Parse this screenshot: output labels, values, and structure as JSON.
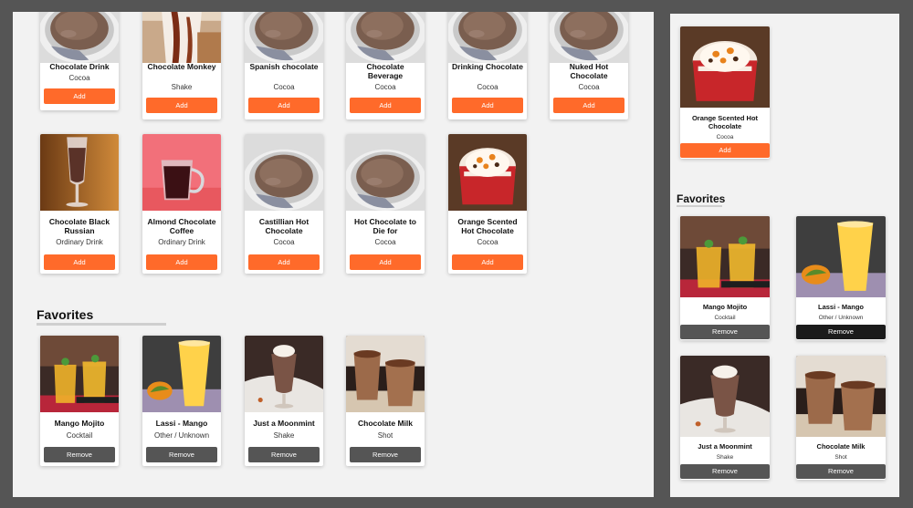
{
  "left": {
    "row1": [
      {
        "name": "Chocolate Drink",
        "category": "Cocoa",
        "button": "Add",
        "image": "cocoa-cup"
      },
      {
        "name": "Chocolate Monkey",
        "category": "Shake",
        "button": "Add",
        "image": "chocolate-monkey"
      },
      {
        "name": "Spanish chocolate",
        "category": "Cocoa",
        "button": "Add",
        "image": "cocoa-cup"
      },
      {
        "name": "Chocolate Beverage",
        "category": "Cocoa",
        "button": "Add",
        "image": "cocoa-cup"
      },
      {
        "name": "Drinking Chocolate",
        "category": "Cocoa",
        "button": "Add",
        "image": "cocoa-cup"
      },
      {
        "name": "Nuked Hot Chocolate",
        "category": "Cocoa",
        "button": "Add",
        "image": "cocoa-cup"
      }
    ],
    "row2": [
      {
        "name": "Chocolate Black Russian",
        "category": "Ordinary Drink",
        "button": "Add",
        "image": "black-russian"
      },
      {
        "name": "Almond Chocolate Coffee",
        "category": "Ordinary Drink",
        "button": "Add",
        "image": "almond-coffee"
      },
      {
        "name": "Castillian Hot Chocolate",
        "category": "Cocoa",
        "button": "Add",
        "image": "cocoa-cup"
      },
      {
        "name": "Hot Chocolate to Die for",
        "category": "Cocoa",
        "button": "Add",
        "image": "cocoa-cup"
      },
      {
        "name": "Orange Scented Hot Chocolate",
        "category": "Cocoa",
        "button": "Add",
        "image": "orange-mug"
      }
    ],
    "favorites_title": "Favorites",
    "favorites": [
      {
        "name": "Mango Mojito",
        "category": "Cocktail",
        "button": "Remove",
        "image": "mango-mojito"
      },
      {
        "name": "Lassi - Mango",
        "category": "Other / Unknown",
        "button": "Remove",
        "image": "lassi-mango"
      },
      {
        "name": "Just a Moonmint",
        "category": "Shake",
        "button": "Remove",
        "image": "moonmint"
      },
      {
        "name": "Chocolate Milk",
        "category": "Shot",
        "button": "Remove",
        "image": "chocolate-milk"
      }
    ]
  },
  "right": {
    "top_card": {
      "name": "Orange Scented Hot Chocolate",
      "category": "Cocoa",
      "button": "Add",
      "image": "orange-mug"
    },
    "favorites_title": "Favorites",
    "favorites": [
      {
        "name": "Mango Mojito",
        "category": "Cocktail",
        "button": "Remove",
        "image": "mango-mojito"
      },
      {
        "name": "Lassi - Mango",
        "category": "Other / Unknown",
        "button": "Remove",
        "image": "lassi-mango"
      },
      {
        "name": "Just a Moonmint",
        "category": "Shake",
        "button": "Remove",
        "image": "moonmint"
      },
      {
        "name": "Chocolate Milk",
        "category": "Shot",
        "button": "Remove",
        "image": "chocolate-milk"
      }
    ]
  },
  "colors": {
    "add_button": "#ff6a2a",
    "remove_button": "#555555",
    "remove_button_hover": "#1b1b1b",
    "panel_background": "#f2f2f2",
    "page_background": "#555555"
  }
}
